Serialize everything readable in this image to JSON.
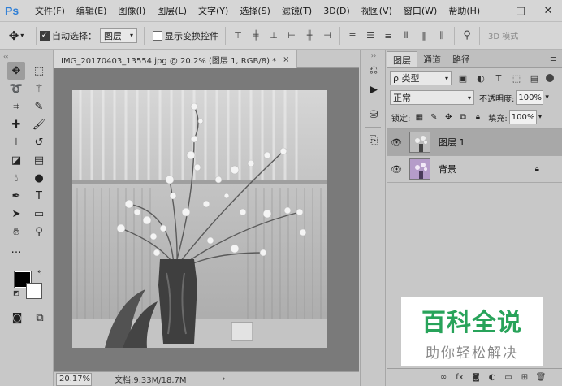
{
  "app": {
    "logo": "Ps",
    "colors": {
      "accent": "#2f7fd6",
      "watermark": "#28a35a"
    }
  },
  "menu": {
    "items": [
      "文件(F)",
      "编辑(E)",
      "图像(I)",
      "图层(L)",
      "文字(Y)",
      "选择(S)",
      "滤镜(T)",
      "3D(D)",
      "视图(V)",
      "窗口(W)",
      "帮助(H)"
    ]
  },
  "window": {
    "minimize": "—",
    "maximize": "□",
    "close": "✕"
  },
  "options": {
    "auto_select_label": "自动选择：",
    "auto_select_value": "图层",
    "show_transform_label": "显示变换控件",
    "mode_3d": "3D 模式"
  },
  "document": {
    "tab_title": "IMG_20170403_13554.jpg @ 20.2% (图层 1, RGB/8) *",
    "tab_close": "×"
  },
  "status": {
    "zoom": "20.17%",
    "docinfo": "文档:9.33M/18.7M",
    "arrow": "›"
  },
  "layers_panel": {
    "tabs": [
      "图层",
      "通道",
      "路径"
    ],
    "filter_label": "ρ 类型",
    "blend_mode": "正常",
    "opacity_label": "不透明度:",
    "opacity_value": "100%",
    "lock_label": "锁定:",
    "fill_label": "填充:",
    "fill_value": "100%",
    "layers": [
      {
        "name": "图层 1",
        "selected": true,
        "locked": false
      },
      {
        "name": "背景",
        "selected": false,
        "locked": true
      }
    ]
  },
  "watermark": {
    "title": "百科全说",
    "subtitle": "助你轻松解决"
  }
}
